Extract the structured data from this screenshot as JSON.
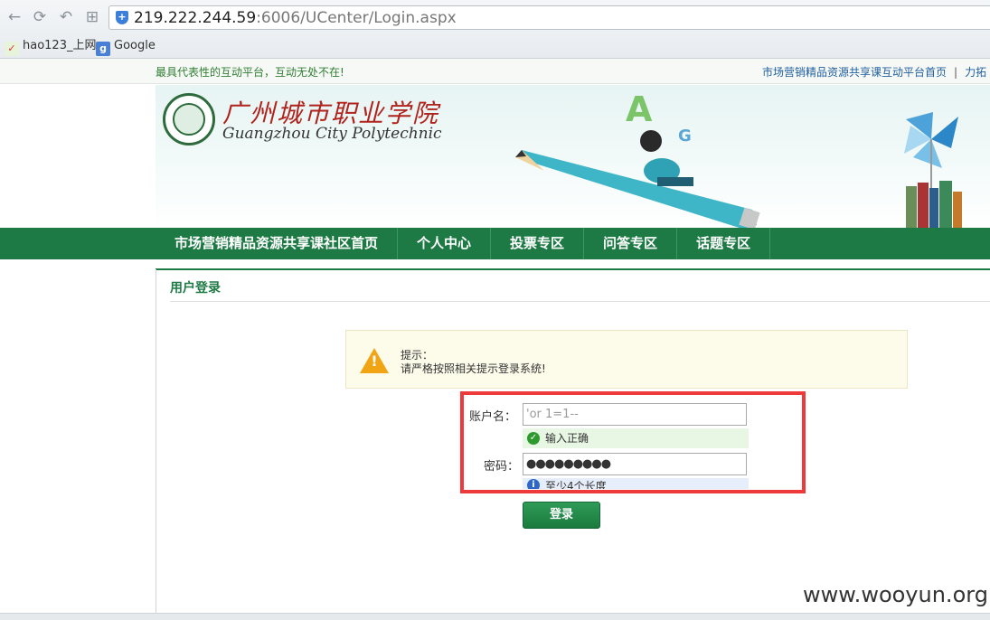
{
  "browser": {
    "url_host": "219.222.244.59",
    "url_rest": ":6006/UCenter/Login.aspx",
    "bookmarks": [
      {
        "label": "hao123_上网",
        "icon": "hao123-icon"
      },
      {
        "label": "Google",
        "icon": "google-icon"
      }
    ]
  },
  "topstrip": {
    "slogan": "最具代表性的互动平台，互动无处不在!",
    "link_home": "市场营销精品资源共享课互动平台首页",
    "link_more": "力拓"
  },
  "banner": {
    "school_cn": "广州城市职业学院",
    "school_en": "Guangzhou City Polytechnic"
  },
  "nav": {
    "items": [
      "市场营销精品资源共享课社区首页",
      "个人中心",
      "投票专区",
      "问答专区",
      "话题专区"
    ]
  },
  "login": {
    "title": "用户登录",
    "tip_title": "提示：",
    "tip_text": "请严格按照相关提示登录系统!",
    "username_label": "账户名：",
    "username_value": "'or 1=1--",
    "username_ok": "输入正确",
    "password_label": "密码：",
    "password_value": "●●●●●●●●●",
    "password_hint": "至少4个长度",
    "submit_label": "登录"
  },
  "watermark": "www.wooyun.org",
  "colors": {
    "nav_green": "#1e7a45",
    "highlight_red": "#ee3a3a",
    "tip_bg": "#fdfbea"
  }
}
